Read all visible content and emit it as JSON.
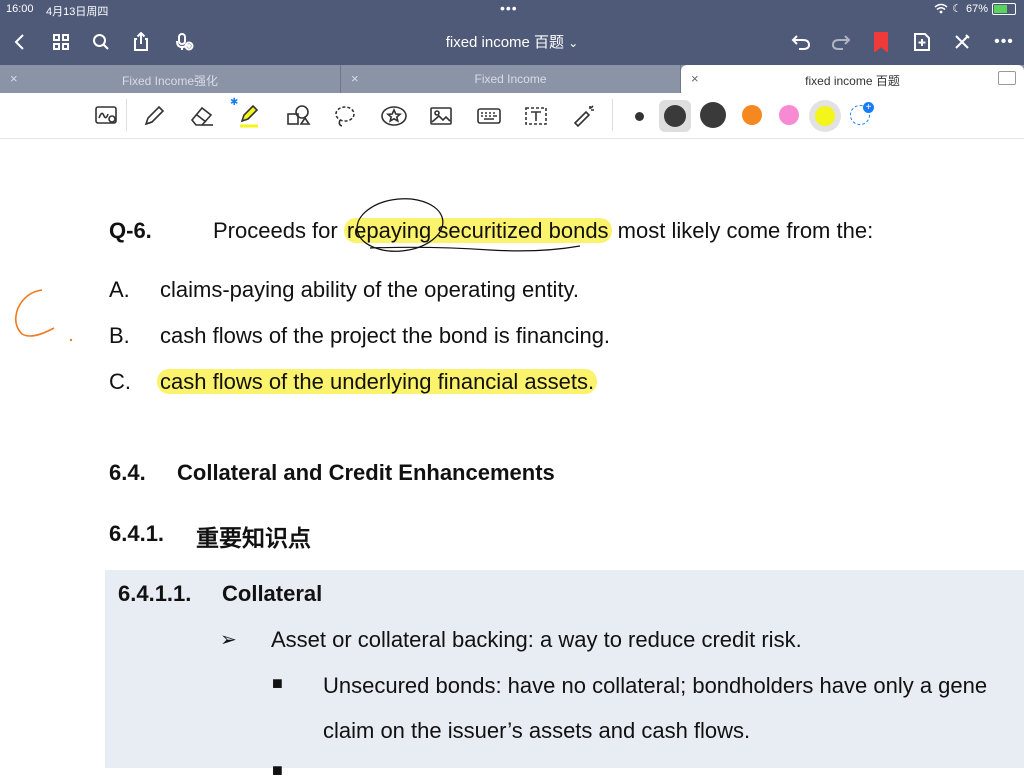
{
  "status": {
    "time": "16:00",
    "date": "4月13日周四",
    "battery": "67%",
    "battery_level": 0.67,
    "dots": "•••"
  },
  "nav": {
    "title": "fixed income 百题",
    "title_chevron": "⌄",
    "more": "•••"
  },
  "tabs": [
    {
      "label": "Fixed Income强化",
      "close": "×"
    },
    {
      "label": "Fixed Income",
      "close": "×"
    },
    {
      "label": "fixed income 百题",
      "close": "×",
      "active": true
    }
  ],
  "colors": {
    "accent_red": "#f03a3a",
    "highlight": "#fbf36b",
    "orange": "#f5891f",
    "pink": "#f78ad3",
    "yellow": "#f4f51a",
    "blue": "#1a7cf5",
    "ink_orange": "#f07a20"
  },
  "annotation": {
    "handwritten": "C",
    "dot": "."
  },
  "question": {
    "number": "Q-6.",
    "text_before": "Proceeds for ",
    "text_highlight": "repaying securitized bonds",
    "text_after": " most likely come from the:",
    "options": [
      {
        "letter": "A.",
        "text": "claims-paying ability of the operating entity."
      },
      {
        "letter": "B.",
        "text": "cash flows of the project the bond is financing."
      },
      {
        "letter": "C.",
        "text": "cash flows of the underlying financial assets."
      }
    ]
  },
  "section": {
    "number": "6.4.",
    "title": "Collateral and Credit Enhancements"
  },
  "subsection": {
    "number": "6.4.1.",
    "title": "重要知识点"
  },
  "subsubsection": {
    "number": "6.4.1.1.",
    "title": "Collateral"
  },
  "bullets": {
    "arrow_glyph": "➢",
    "square_glyph": "■",
    "l1": "Asset or collateral backing: a way to reduce credit risk.",
    "l2a": "Unsecured bonds: have no collateral; bondholders have only a gene",
    "l2b": "claim on the issuer’s assets and cash flows."
  }
}
